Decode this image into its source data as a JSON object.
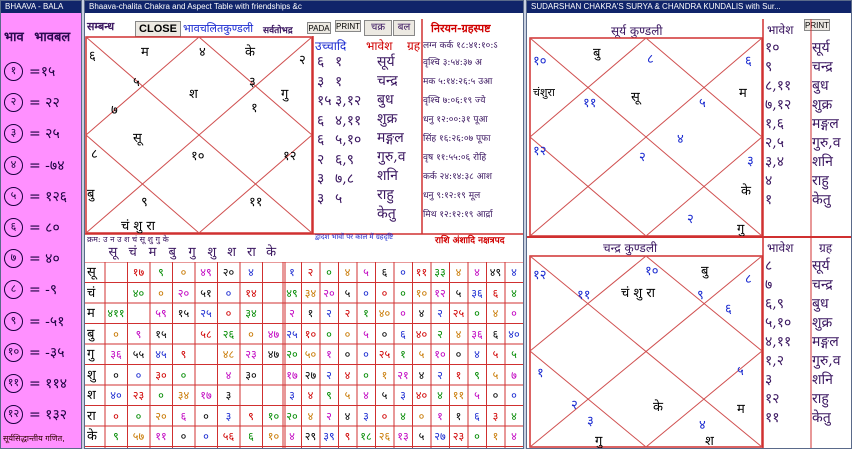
{
  "bala": {
    "title": "BHAAVA - BALA",
    "col1": "भाव",
    "col2": "भावबल",
    "rows": [
      {
        "n": "१",
        "v": "=१५"
      },
      {
        "n": "२",
        "v": "= २२"
      },
      {
        "n": "३",
        "v": "= २५"
      },
      {
        "n": "४",
        "v": "= -७४"
      },
      {
        "n": "५",
        "v": "= १२६"
      },
      {
        "n": "६",
        "v": "= ८०"
      },
      {
        "n": "७",
        "v": "= ४०"
      },
      {
        "n": "८",
        "v": "= -९"
      },
      {
        "n": "९",
        "v": "= -५१"
      },
      {
        "n": "१०",
        "v": "= -३५"
      },
      {
        "n": "११",
        "v": "= ११४"
      },
      {
        "n": "१२",
        "v": "= १३२"
      }
    ],
    "footer": "सूर्यसिद्धान्तीय गणित,"
  },
  "main": {
    "title": "Bhaava-chalita Chakra and Aspect Table with friendships &c",
    "sambandh": "सम्बन्ध",
    "close": "CLOSE",
    "chart_title": "भावचलितकुण्डली",
    "sarvato": "सर्वतोभद्र",
    "pada": "PADA",
    "print": "PRINT",
    "chakra": "चक्र",
    "bal": "बल",
    "chart": {
      "h1": "२",
      "h2": "४",
      "h3": "३",
      "h4": "१",
      "h5": "२",
      "h6": "१२",
      "h7": "१०",
      "h8": "११",
      "h9": "९",
      "h10": "७",
      "h11": "५",
      "h12": "६",
      "h13": "८",
      "p1": "म",
      "p2": "श",
      "p3": "गु",
      "p4": "के",
      "p5": "सू",
      "p6": "बु",
      "p7": "चं शु रा"
    },
    "ucchadi": "उच्चादि",
    "bhaavesh": "भावेश",
    "grah": "ग्रह",
    "rel_rows": [
      "६",
      "३",
      "१५",
      "६",
      "६",
      "२",
      "३",
      "३"
    ],
    "rel_col2": [
      "१",
      "१",
      "३,१२",
      "४,११",
      "५,१०",
      "६,९",
      "७,८",
      "५"
    ],
    "planets": [
      "सूर्य",
      "चन्द्र",
      "बुध",
      "शुक्र",
      "मङ्गल",
      "गुरु,व",
      "शनि",
      "राहु",
      "केतु"
    ],
    "nirayan": "निरयन-ग्रहस्पष्ट",
    "lagna": "लग्न कर्क १८:४१:१०:ऽ",
    "positions": [
      "वृश्चि ३:५४:३७ अ",
      "मक ५:१४:२६:५ उआ",
      "वृश्चि ७:०६:१९ ज्ये",
      "धनु १२:००:३१ पूआ",
      "सिंह १६:२६:०७ पूफा",
      "वृष ११:५५:०६ रोहि",
      "कर्क २४:१४:३८ आश",
      "धनु ९:१२:१९ मूल",
      "मिथ १२:१२:१९ आर्द्रा"
    ],
    "aspect_header": "क्रम: उ न  उ  श चं  सू  शु गु  के",
    "aspect_mid": "द्वादश भावों पर काल में ग्रहदृष्टि",
    "aspect_right": "राशि अंशादि नक्षत्रपद",
    "col_heads": [
      "सू",
      "चं",
      "म",
      "बु",
      "गु",
      "शु",
      "श",
      "रा",
      "के"
    ],
    "row_heads": [
      "सू",
      "चं",
      "म",
      "बु",
      "गु",
      "शु",
      "श",
      "रा",
      "के"
    ],
    "grid_left": [
      [
        "",
        "१७",
        "९",
        "०",
        "४९",
        "२०",
        "४",
        ""
      ],
      [
        "",
        "४०",
        "०",
        "२०",
        "५१",
        "०",
        "१४",
        ""
      ],
      [
        "४११",
        "",
        "५९",
        "१५",
        "२५",
        "०",
        "३४",
        ""
      ],
      [
        "०",
        "९",
        "१५",
        "",
        "५८",
        "२६",
        "०",
        "४७"
      ],
      [
        "३६",
        "५५",
        "४५",
        "९",
        "",
        "४८",
        "२३",
        "४७"
      ],
      [
        "०",
        "०",
        "३०",
        "०",
        "",
        "४",
        "३०",
        ""
      ],
      [
        "४०",
        "२३",
        "०",
        "३४",
        "१७",
        "३",
        "",
        ""
      ],
      [
        "०",
        "०",
        "२०",
        "६",
        "०",
        "३",
        "९",
        "१०"
      ],
      [
        "९",
        "५७",
        "११",
        "०",
        "०",
        "५६",
        "६",
        "१०"
      ]
    ],
    "grid_right": [
      [
        "१",
        "२",
        "०",
        "४",
        "५",
        "६",
        "०",
        "११",
        "३३",
        "४",
        "४",
        "४९",
        "४"
      ],
      [
        "४९",
        "३४",
        "२०",
        "५",
        "०",
        "०",
        "०",
        "१०",
        "१२",
        "५",
        "३६",
        "६",
        "४"
      ],
      [
        "२",
        "१",
        "२",
        "२",
        "१",
        "४०",
        "०",
        "४",
        "२",
        "२५",
        "०",
        "४",
        "०"
      ],
      [
        "२५",
        "१०",
        "०",
        "०",
        "५",
        "०",
        "६",
        "४०",
        "२",
        "४",
        "३६",
        "६",
        "४०"
      ],
      [
        "२०",
        "५०",
        "१",
        "०",
        "०",
        "२५",
        "१",
        "५",
        "१०",
        "०",
        "४",
        "५",
        "५"
      ],
      [
        "१७",
        "२७",
        "२",
        "४",
        "०",
        "१",
        "२१",
        "४",
        "२",
        "१",
        "९",
        "५",
        "७"
      ],
      [
        "३",
        "४",
        "९",
        "५",
        "४",
        "५",
        "३",
        "४०",
        "४",
        "११",
        "५",
        "०",
        "०"
      ],
      [
        "२०",
        "४",
        "२",
        "४",
        "३",
        "०",
        "४",
        "०",
        "१",
        "१",
        "६",
        "३",
        "४"
      ],
      [
        "४",
        "२९",
        "३९",
        "९",
        "१८",
        "२६",
        "१३",
        "५",
        "२७",
        "२३",
        "०",
        "१",
        "४"
      ]
    ]
  },
  "sud": {
    "title": "SUDARSHAN CHAKRA'S SURYA & CHANDRA KUNDALIS with Sur...",
    "print": "PRINT",
    "surya_title": "सूर्य कुण्डली",
    "chandra_title": "चन्द्र कुण्डली",
    "bhaavesh": "भावेश",
    "grah": "ग्रह",
    "surya": {
      "a": "१०",
      "b": "बु",
      "c": "८",
      "d": "६",
      "e": "म",
      "f": "चंशुरा",
      "g": "११",
      "h": "सू",
      "i": "५",
      "j": "४",
      "k": "२",
      "l": "१२",
      "m": "३",
      "n": "के",
      "o": "२",
      "p": "गु"
    },
    "chandra": {
      "a": "१२",
      "b": "१०",
      "c": "बु",
      "d": "८",
      "e": "चं शु रा",
      "f": "९",
      "g": "६",
      "h": "११",
      "i": "१",
      "j": "२",
      "k": "५",
      "l": "३",
      "m": "के",
      "n": "४",
      "o": "म",
      "p": "गु",
      "q": "श",
      "r": "३"
    },
    "sb_vals": [
      "१०",
      "९",
      "८,११",
      "७,१२",
      "१,६",
      "२,५",
      "३,४",
      "४",
      "१"
    ],
    "cb_vals": [
      "८",
      "७",
      "६,९",
      "५,१०",
      "४,११",
      "१,२",
      "३",
      "१२",
      "११"
    ],
    "planets": [
      "सूर्य",
      "चन्द्र",
      "बुध",
      "शुक्र",
      "मङ्गल",
      "गुरु,व",
      "शनि",
      "राहु",
      "केतु"
    ]
  }
}
